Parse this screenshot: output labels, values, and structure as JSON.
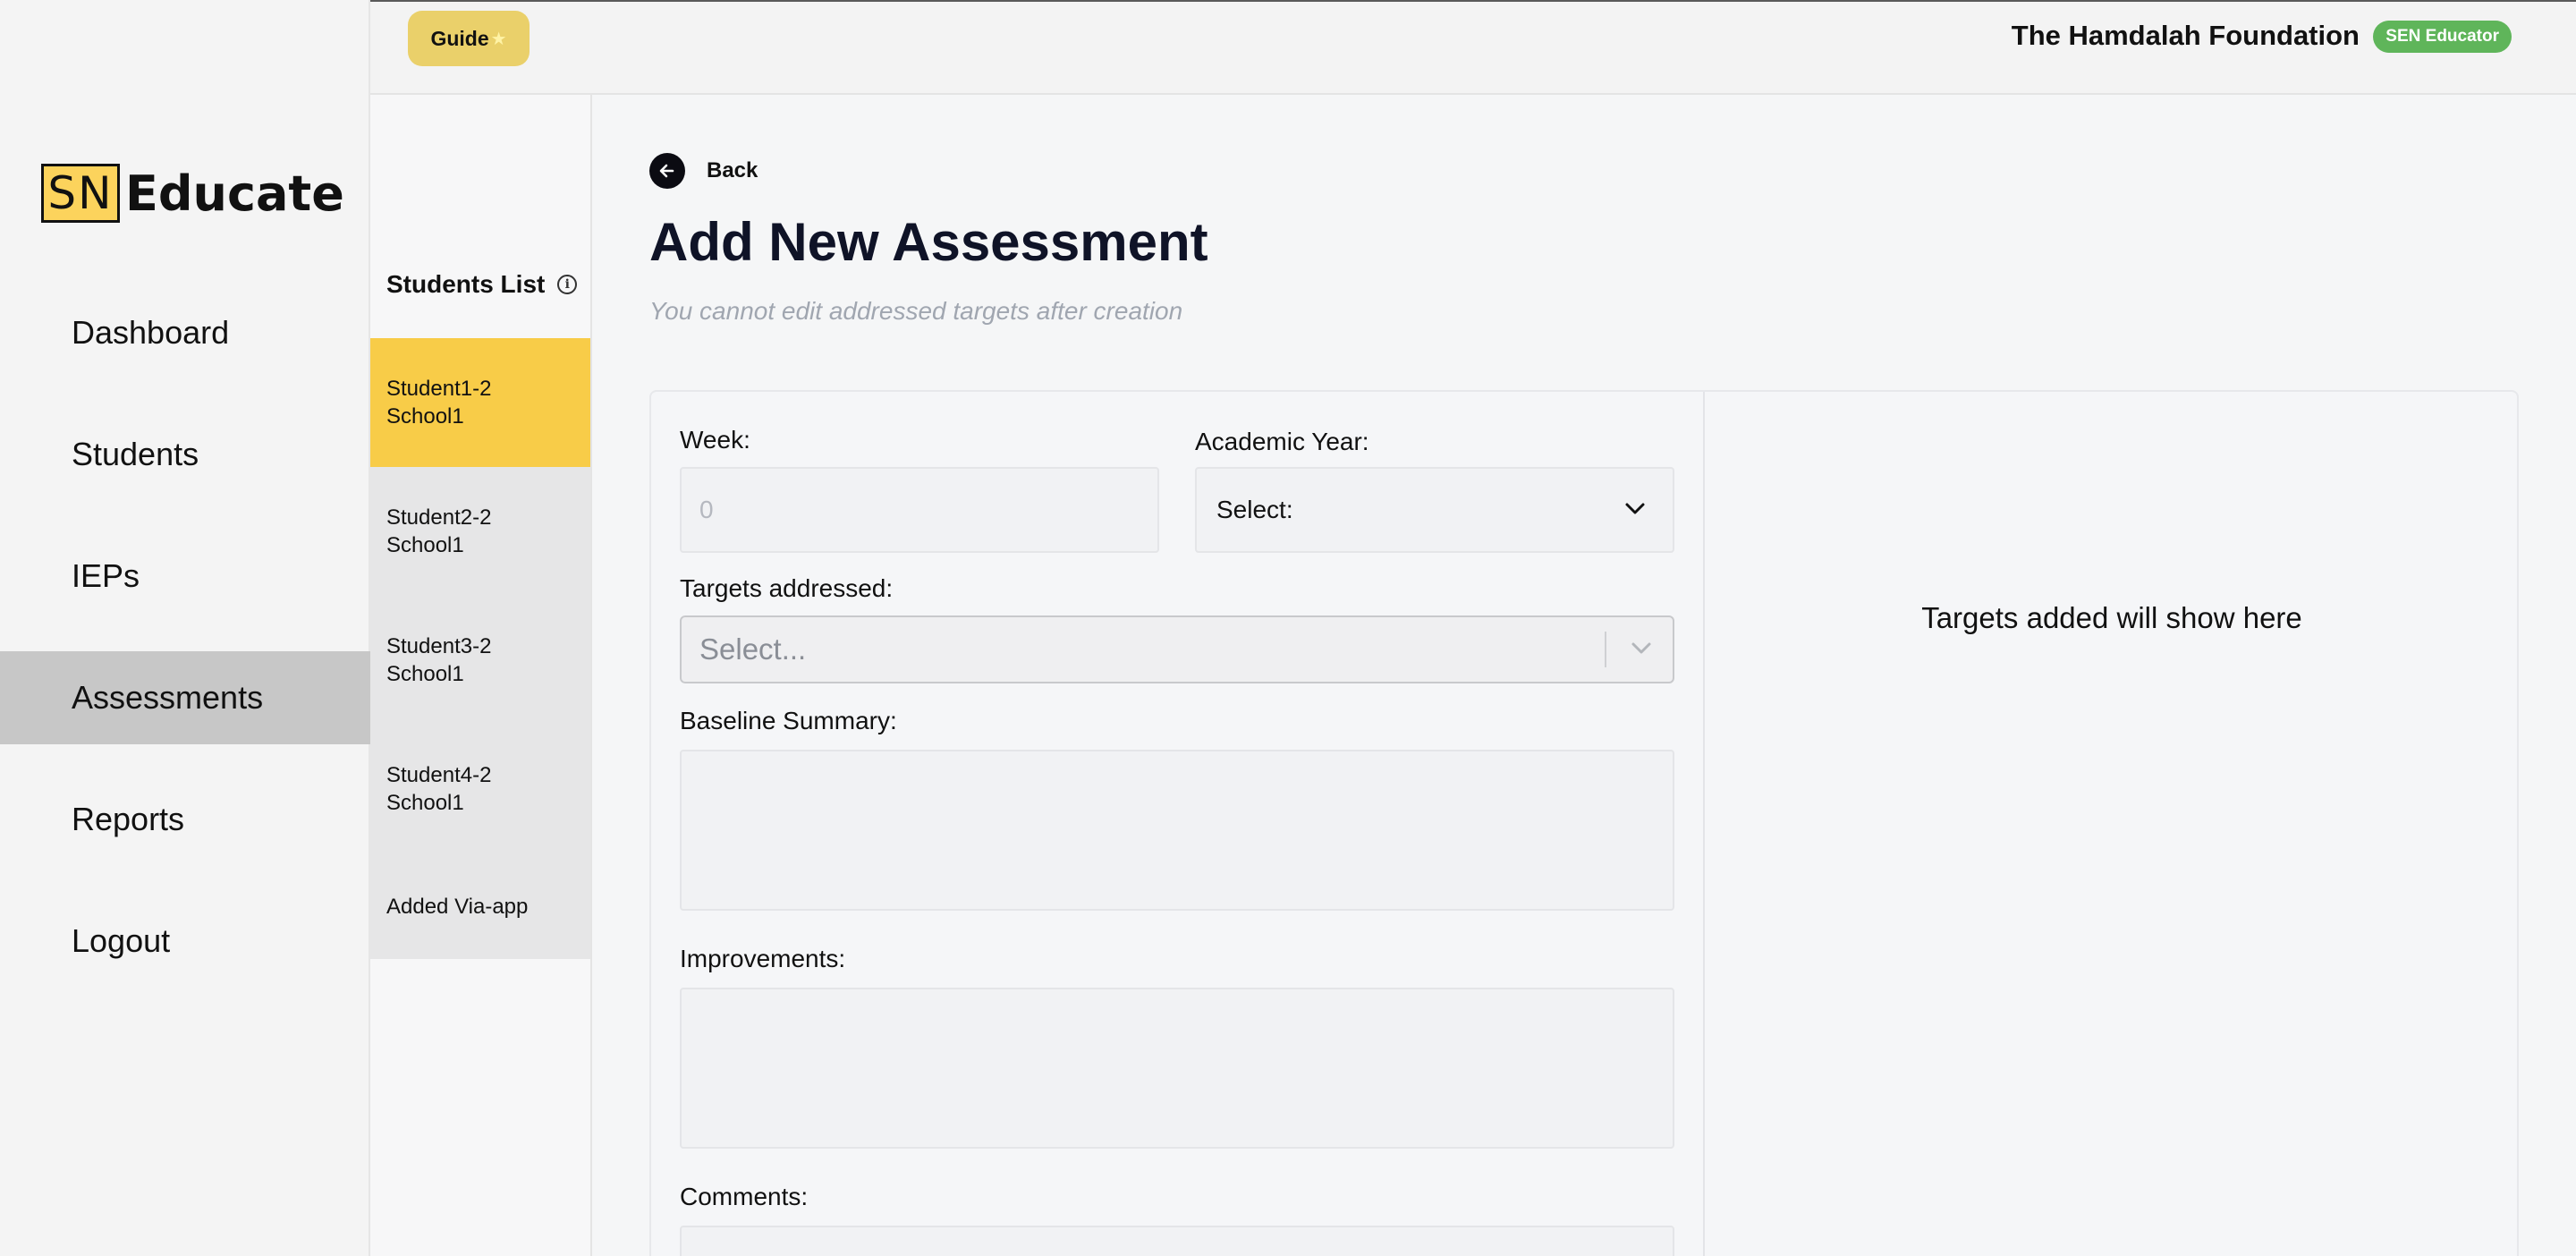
{
  "sidebar": {
    "logo": {
      "sn": "SN",
      "text": "Educate"
    },
    "items": [
      {
        "label": "Dashboard",
        "active": false
      },
      {
        "label": "Students",
        "active": false
      },
      {
        "label": "IEPs",
        "active": false
      },
      {
        "label": "Assessments",
        "active": true
      },
      {
        "label": "Reports",
        "active": false
      },
      {
        "label": "Logout",
        "active": false
      }
    ]
  },
  "topbar": {
    "guide_label": "Guide",
    "guide_icon": "star-icon",
    "org_name": "The Hamdalah Foundation",
    "role_badge": "SEN Educator"
  },
  "students_panel": {
    "title": "Students List",
    "info_icon": "info-icon",
    "students": [
      {
        "label": "Student1-2\nSchool1",
        "selected": true
      },
      {
        "label": "Student2-2\nSchool1",
        "selected": false
      },
      {
        "label": "Student3-2\nSchool1",
        "selected": false
      },
      {
        "label": "Student4-2\nSchool1",
        "selected": false
      },
      {
        "label": "Added Via-app",
        "selected": false
      }
    ]
  },
  "main": {
    "back_label": "Back",
    "title": "Add New Assessment",
    "subtitle": "You cannot edit addressed targets after creation",
    "form": {
      "week_label": "Week:",
      "week_placeholder": "0",
      "academic_year_label": "Academic Year:",
      "academic_year_value": "Select:",
      "targets_label": "Targets addressed:",
      "targets_placeholder": "Select...",
      "baseline_label": "Baseline Summary:",
      "improvements_label": "Improvements:",
      "comments_label": "Comments:"
    },
    "targets_empty_text": "Targets added will show here"
  },
  "colors": {
    "accent_yellow": "#f8cc48",
    "guide_button": "#ead06a",
    "badge_green": "#5fb55a",
    "active_nav": "#c7c7c7",
    "title_navy": "#0f1327"
  }
}
